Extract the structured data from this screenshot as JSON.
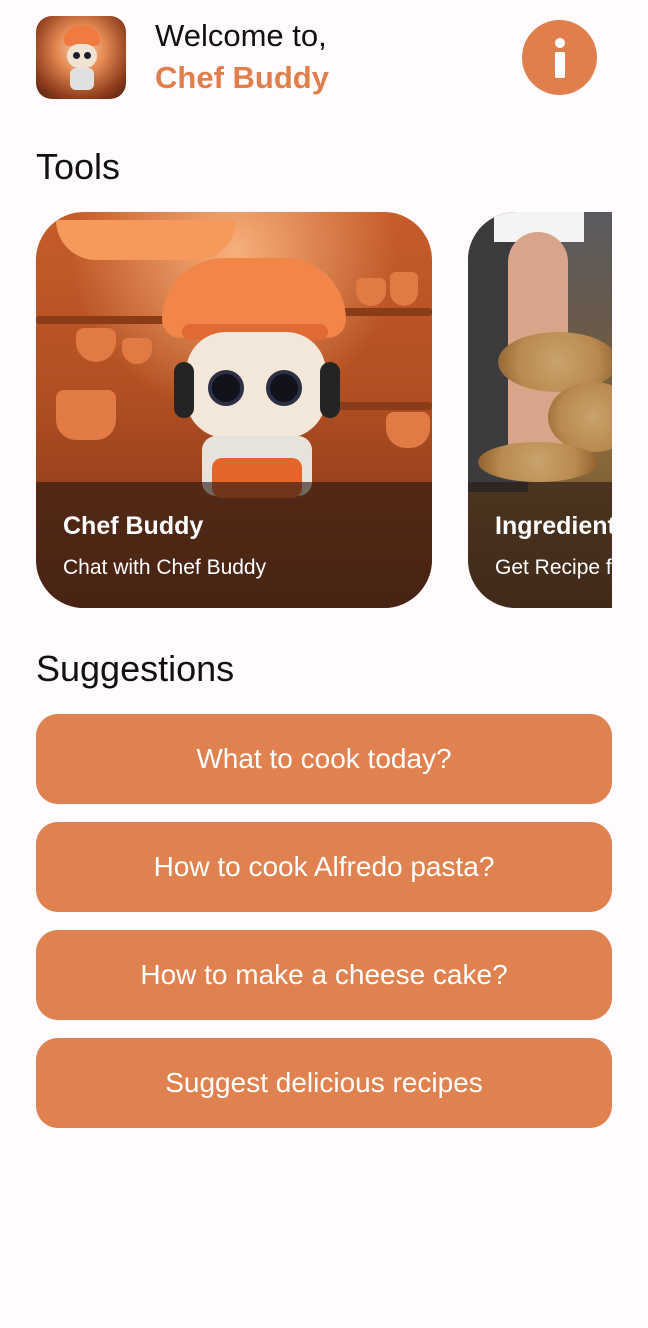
{
  "header": {
    "welcome_text": "Welcome to,",
    "brand_name": "Chef Buddy",
    "avatar_icon": "chef-robot-avatar",
    "info_icon": "info-icon"
  },
  "tools": {
    "title": "Tools",
    "cards": [
      {
        "title": "Chef Buddy",
        "subtitle": "Chat with Chef Buddy",
        "image": "robot-chef-kitchen"
      },
      {
        "title": "Ingredients",
        "subtitle": "Get Recipe from Ingredients",
        "image": "hands-with-ingredients"
      }
    ]
  },
  "suggestions": {
    "title": "Suggestions",
    "items": [
      "What to cook today?",
      "How to cook Alfredo pasta?",
      "How to make a cheese cake?",
      "Suggest delicious recipes"
    ]
  },
  "colors": {
    "accent": "#e07f4c",
    "background": "#fffbfe"
  }
}
